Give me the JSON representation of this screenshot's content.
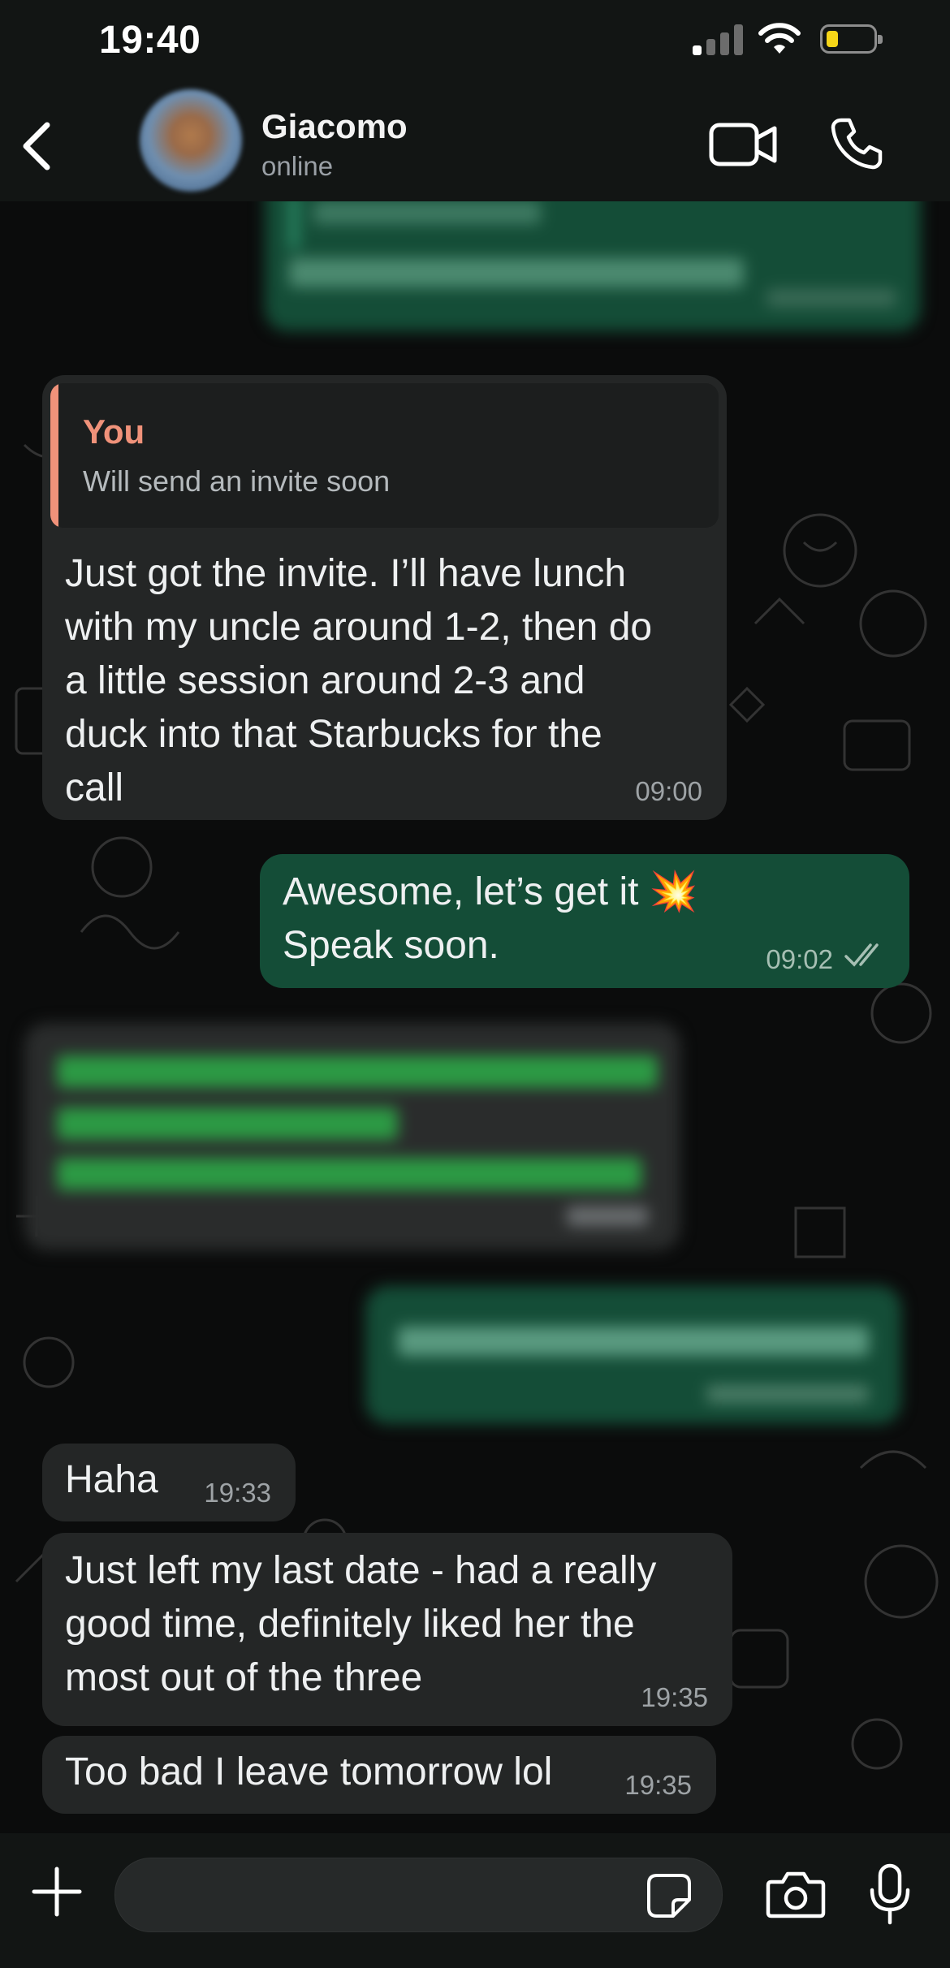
{
  "status_bar": {
    "time": "19:40",
    "battery_level": 0.2
  },
  "header": {
    "contact_name": "Giacomo",
    "contact_status": "online"
  },
  "messages": [
    {
      "direction": "in",
      "quote": {
        "author": "You",
        "text": "Will send an invite soon"
      },
      "lines": [
        "Just got the invite. I’ll have lunch",
        "with my uncle around 1-2, then do",
        "a little session around 2-3 and",
        "duck into that Starbucks for the",
        "call"
      ],
      "time": "09:00"
    },
    {
      "direction": "out",
      "lines": [
        "Awesome, let’s get it 💥",
        "Speak soon."
      ],
      "time": "09:02",
      "status": "read"
    },
    {
      "direction": "in",
      "text": "Haha",
      "time": "19:33"
    },
    {
      "direction": "in",
      "lines": [
        "Just left my last date - had a really",
        "good time, definitely liked her the",
        "most out of the three"
      ],
      "time": "19:35"
    },
    {
      "direction": "in",
      "text": "Too bad I leave tomorrow lol",
      "time": "19:35"
    }
  ],
  "colors": {
    "incoming_bubble": "#242626",
    "outgoing_bubble": "#144d37",
    "quote_accent": "#f0927a",
    "background": "#0b0c0c"
  },
  "icons": [
    "back-chevron-icon",
    "video-call-icon",
    "phone-icon",
    "plus-icon",
    "sticker-icon",
    "camera-icon",
    "microphone-icon"
  ]
}
